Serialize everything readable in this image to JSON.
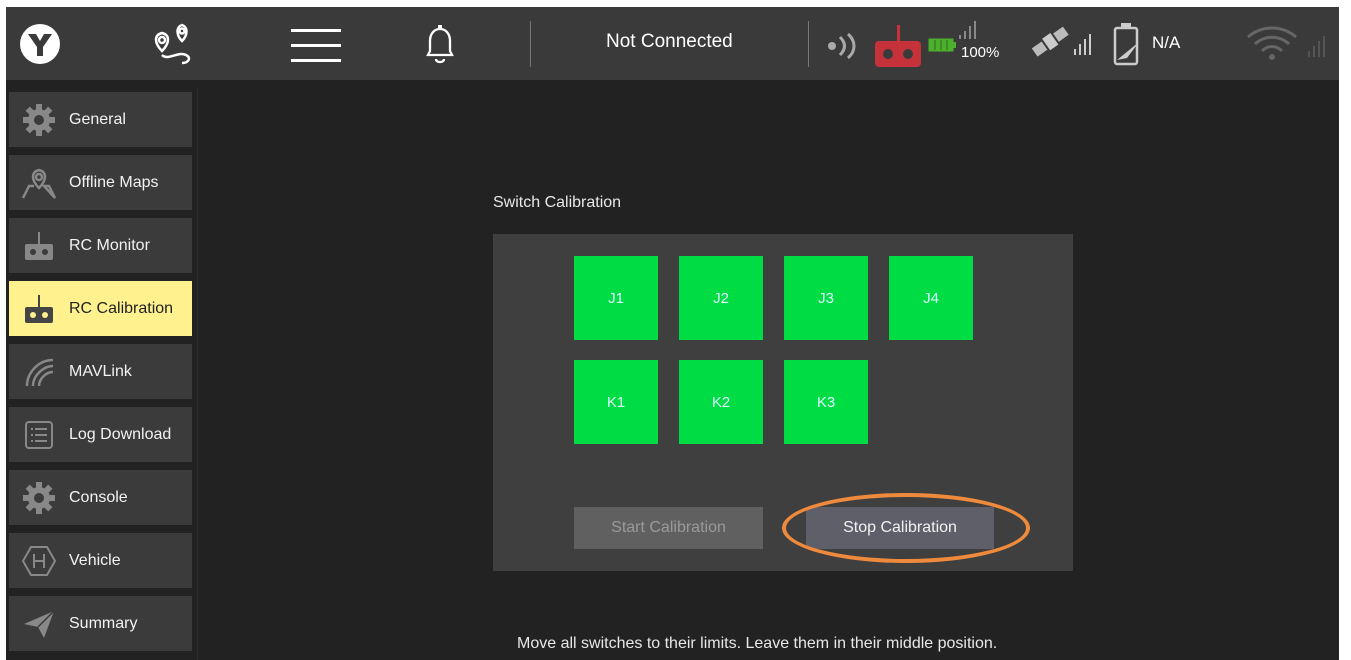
{
  "topbar": {
    "connection_status": "Not Connected",
    "rc_battery": "100%",
    "vehicle_battery": "N/A",
    "icons": [
      "logo-icon",
      "map-pin-route-icon",
      "menu-icon",
      "bell-icon",
      "signal-strength-icon",
      "rc-controller-icon",
      "battery-icon",
      "satellite-icon",
      "vehicle-battery-icon",
      "wifi-icon"
    ],
    "colors": {
      "rc_icon": "#c5323a",
      "battery": "#4caf2e"
    }
  },
  "sidebar": {
    "items": [
      {
        "label": "General",
        "icon": "gear-icon"
      },
      {
        "label": "Offline Maps",
        "icon": "map-icon"
      },
      {
        "label": "RC Monitor",
        "icon": "rc-controller-icon"
      },
      {
        "label": "RC Calibration",
        "icon": "rc-controller-icon"
      },
      {
        "label": "MAVLink",
        "icon": "signal-waves-icon"
      },
      {
        "label": "Log Download",
        "icon": "list-icon"
      },
      {
        "label": "Console",
        "icon": "gear-icon"
      },
      {
        "label": "Vehicle",
        "icon": "hexagon-h-icon"
      },
      {
        "label": "Summary",
        "icon": "paper-plane-icon"
      }
    ],
    "active_item": "RC Calibration",
    "active_color": "#fff28e"
  },
  "main": {
    "title": "Switch Calibration",
    "switches": [
      "J1",
      "J2",
      "J3",
      "J4",
      "K1",
      "K2",
      "K3"
    ],
    "switch_color": "#00dd44",
    "start_button": "Start Calibration",
    "stop_button": "Stop Calibration",
    "hint": "Move all switches to their limits. Leave them in their middle position.",
    "highlight_color": "#ef8a3c"
  }
}
